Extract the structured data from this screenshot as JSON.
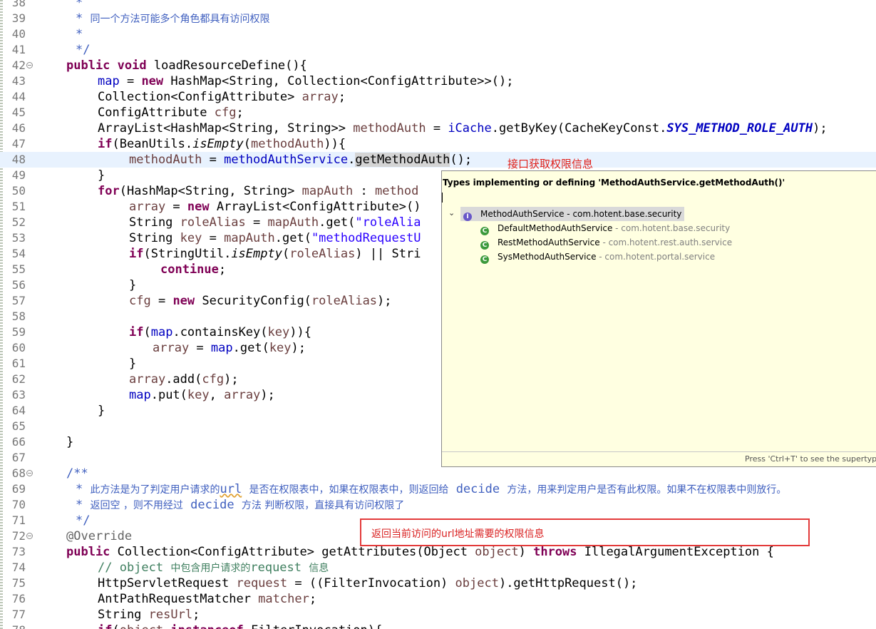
{
  "editor": {
    "line_numbers": [
      "38",
      "39",
      "40",
      "41",
      "42",
      "43",
      "44",
      "45",
      "46",
      "47",
      "48",
      "49",
      "50",
      "51",
      "52",
      "53",
      "54",
      "55",
      "56",
      "57",
      "58",
      "59",
      "60",
      "61",
      "62",
      "63",
      "64",
      "65",
      "66",
      "67",
      "68",
      "69",
      "70",
      "71",
      "72",
      "73",
      "74",
      "75",
      "76",
      "77",
      "78"
    ]
  },
  "annotations": {
    "note1": "接口获取权限信息",
    "note2": "返回当前访问的url地址需要的权限信息"
  },
  "popup": {
    "title": "Types implementing or defining 'MethodAuthService.getMethodAuth()'",
    "root": {
      "name": "MethodAuthService",
      "pkg": " - com.hotent.base.security"
    },
    "children": [
      {
        "name": "DefaultMethodAuthService",
        "pkg": " - com.hotent.base.security"
      },
      {
        "name": "RestMethodAuthService",
        "pkg": " - com.hotent.rest.auth.service"
      },
      {
        "name": "SysMethodAuthService",
        "pkg": " - com.hotent.portal.service"
      }
    ],
    "status": "Press 'Ctrl+T' to see the supertype h"
  },
  "colors": {
    "keyword": "#7f0055",
    "field": "#0000c0",
    "string": "#2a00ff",
    "javadoc": "#3f5fbf",
    "comment": "#3f7f5f",
    "annotation_red": "#e0201a",
    "popup_bg": "#ffffe1"
  },
  "icons": {
    "interface_icon": "interface-icon",
    "class_icon": "class-icon",
    "fold_icon": "fold-collapse-icon",
    "chevron": "chevron-down-icon"
  }
}
